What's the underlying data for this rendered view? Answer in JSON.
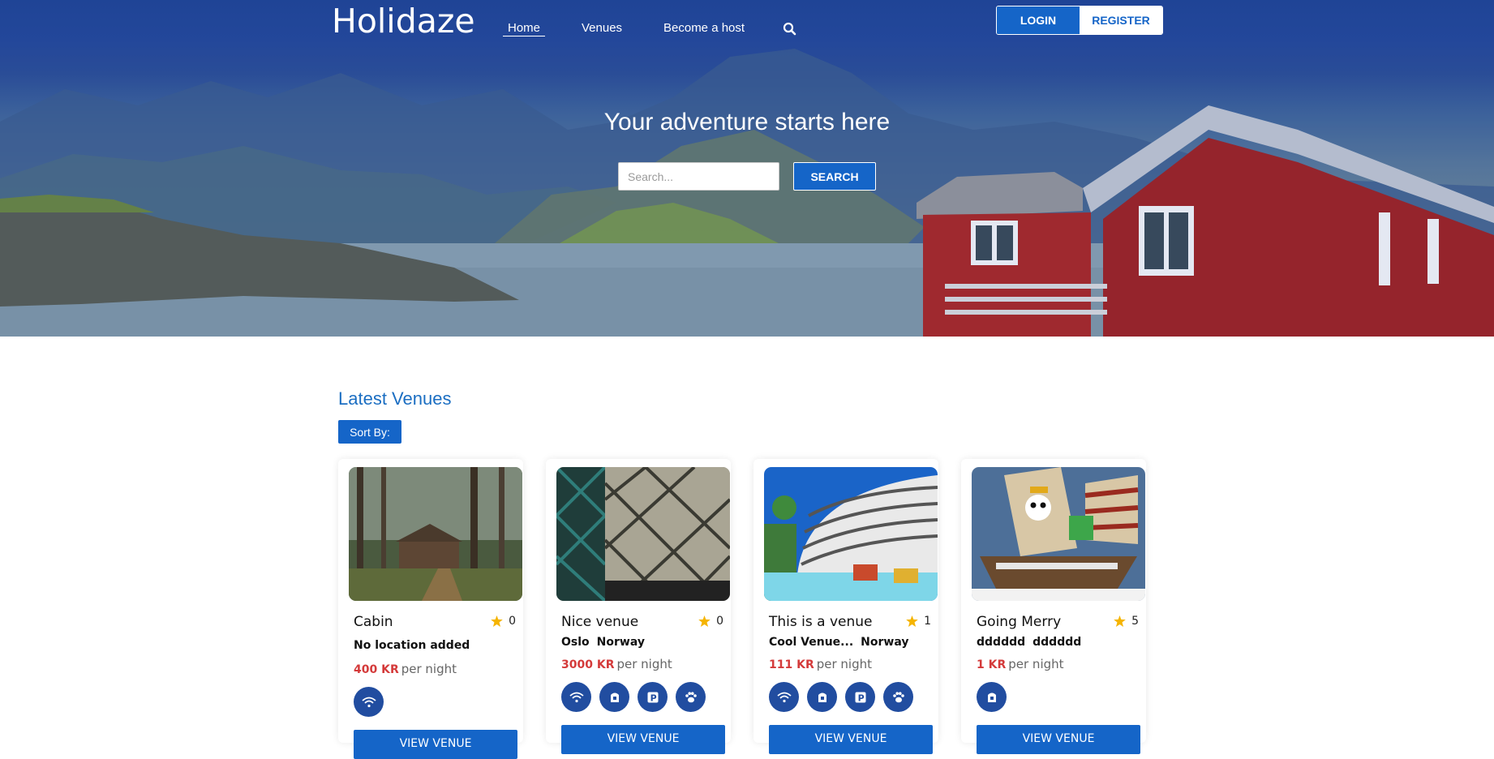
{
  "brand": "Holidaze",
  "nav": {
    "home": "Home",
    "venues": "Venues",
    "become_host": "Become a host"
  },
  "auth": {
    "login": "LOGIN",
    "register": "REGISTER"
  },
  "hero": {
    "title": "Your adventure starts here",
    "search_placeholder": "Search...",
    "search_button": "SEARCH"
  },
  "section": {
    "title": "Latest Venues",
    "sort_label": "Sort By:"
  },
  "colors": {
    "primary": "#1565c8",
    "header_blue": "#1f4597",
    "amenity": "#214da0",
    "price": "#d43a3a",
    "star": "#f5b400"
  },
  "venues": [
    {
      "name": "Cabin",
      "rating": "0",
      "location_note": "No location added",
      "price": "400 KR",
      "per": "per night",
      "amenities": [
        "wifi-icon"
      ],
      "view": "VIEW VENUE"
    },
    {
      "name": "Nice venue",
      "rating": "0",
      "city": "Oslo",
      "country": "Norway",
      "price": "3000 KR",
      "per": "per night",
      "amenities": [
        "wifi-icon",
        "breakfast-icon",
        "parking-icon",
        "pets-icon"
      ],
      "view": "VIEW VENUE"
    },
    {
      "name": "This is a venue",
      "rating": "1",
      "city": "Cool Venue...",
      "country": "Norway",
      "price": "111 KR",
      "per": "per night",
      "amenities": [
        "wifi-icon",
        "breakfast-icon",
        "parking-icon",
        "pets-icon"
      ],
      "view": "VIEW VENUE"
    },
    {
      "name": "Going Merry",
      "rating": "5",
      "city": "dddddd",
      "country": "dddddd",
      "price": "1 KR",
      "per": "per night",
      "amenities": [
        "breakfast-icon"
      ],
      "view": "VIEW VENUE"
    }
  ]
}
